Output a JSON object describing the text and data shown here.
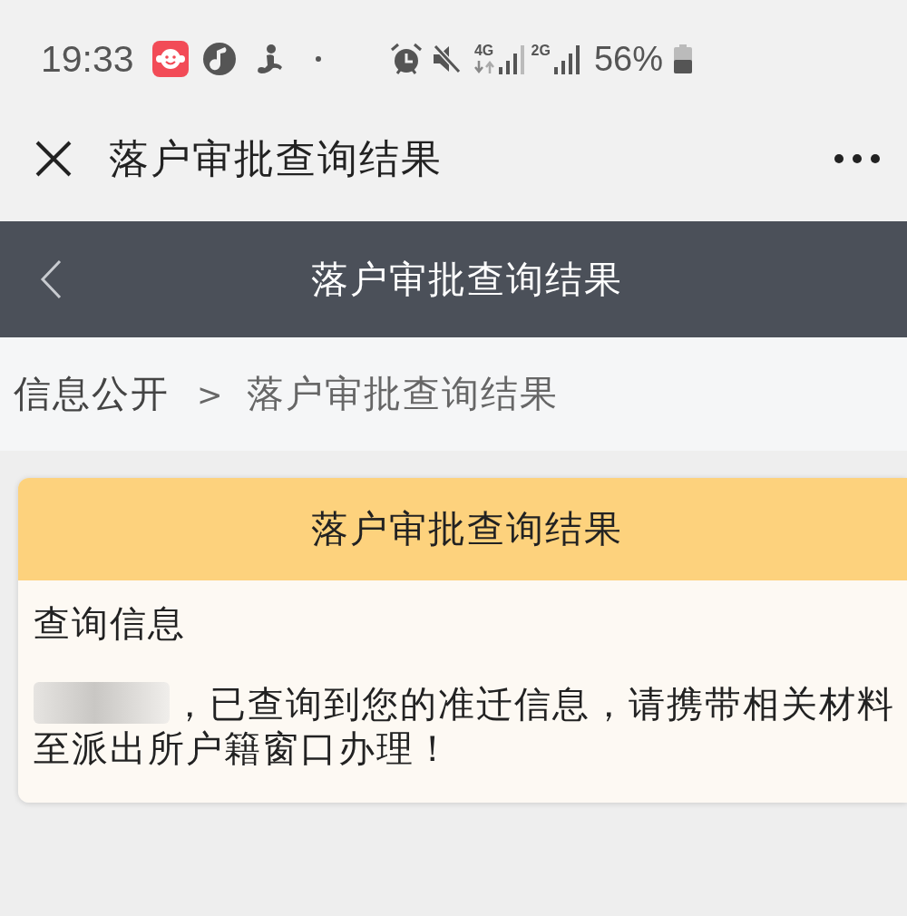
{
  "status_bar": {
    "time": "19:33",
    "networks": [
      {
        "label": "4G",
        "data_activity": true
      },
      {
        "label": "2G",
        "data_activity": false
      }
    ],
    "battery": "56%"
  },
  "top_bar": {
    "title": "落户审批查询结果"
  },
  "page_header": {
    "title": "落户审批查询结果"
  },
  "breadcrumb": {
    "items": [
      "信息公开",
      "落户审批查询结果"
    ],
    "separator": ">"
  },
  "result_card": {
    "title": "落户审批查询结果",
    "section_label": "查询信息",
    "name_blurred": true,
    "message": "，已查询到您的准迁信息，请携带相关材料至派出所户籍窗口办理！"
  }
}
